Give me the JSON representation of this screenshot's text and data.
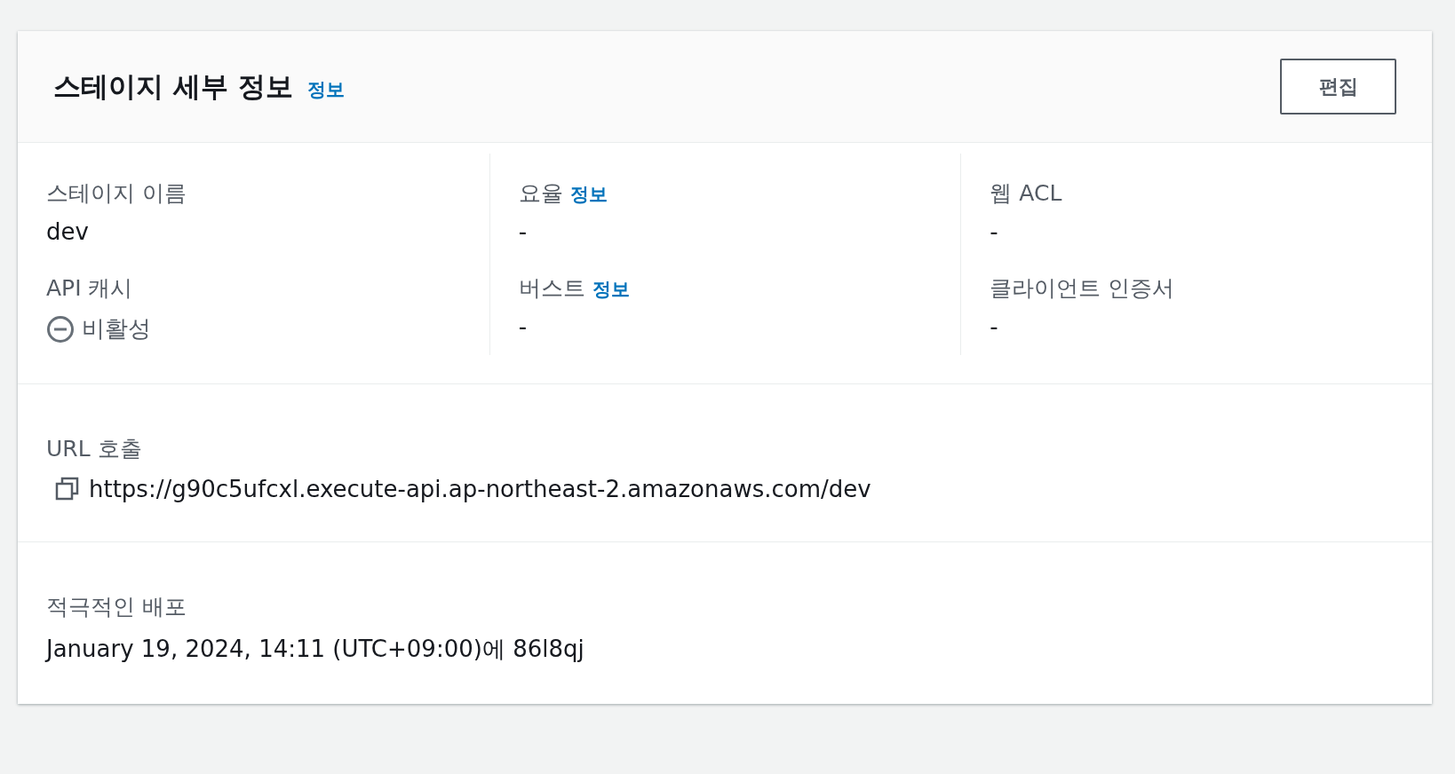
{
  "header": {
    "title": "스테이지 세부 정보",
    "info_link": "정보",
    "edit_button": "편집"
  },
  "columns": [
    {
      "items": [
        {
          "kind": "text",
          "label": "스테이지 이름",
          "value": "dev"
        },
        {
          "kind": "status",
          "label": "API 캐시",
          "value": "비활성"
        }
      ]
    },
    {
      "items": [
        {
          "kind": "text",
          "label": "요율",
          "info_link": "정보",
          "value": "-"
        },
        {
          "kind": "text",
          "label": "버스트",
          "info_link": "정보",
          "value": "-"
        }
      ]
    },
    {
      "items": [
        {
          "kind": "text",
          "label": "웹 ACL",
          "value": "-"
        },
        {
          "kind": "text",
          "label": "클라이언트 인증서",
          "value": "-"
        }
      ]
    }
  ],
  "invoke_url": {
    "label": "URL 호출",
    "value": "https://g90c5ufcxl.execute-api.ap-northeast-2.amazonaws.com/dev"
  },
  "deployment": {
    "label": "적극적인 배포",
    "value": "January 19, 2024, 14:11 (UTC+09:00)에 86l8qj"
  }
}
